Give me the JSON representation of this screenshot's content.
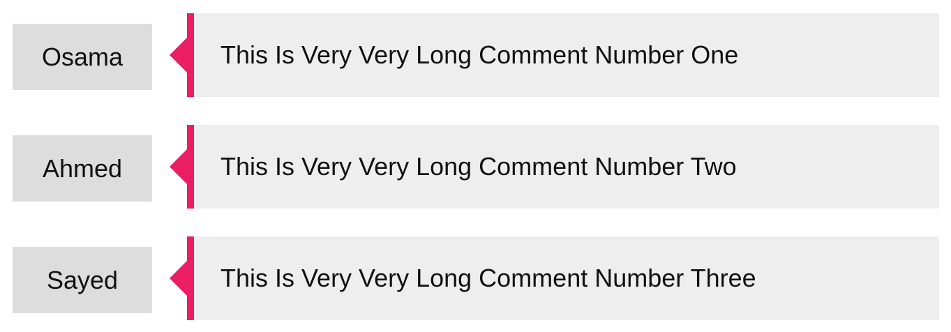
{
  "colors": {
    "accent": "#e91e63",
    "author_bg": "#dddddd",
    "comment_bg": "#eeeeee",
    "text": "#111111"
  },
  "comments": [
    {
      "author": "Osama",
      "text": "This Is Very Very Long Comment Number One"
    },
    {
      "author": "Ahmed",
      "text": "This Is Very Very Long Comment Number Two"
    },
    {
      "author": "Sayed",
      "text": "This Is Very Very Long Comment Number Three"
    }
  ]
}
